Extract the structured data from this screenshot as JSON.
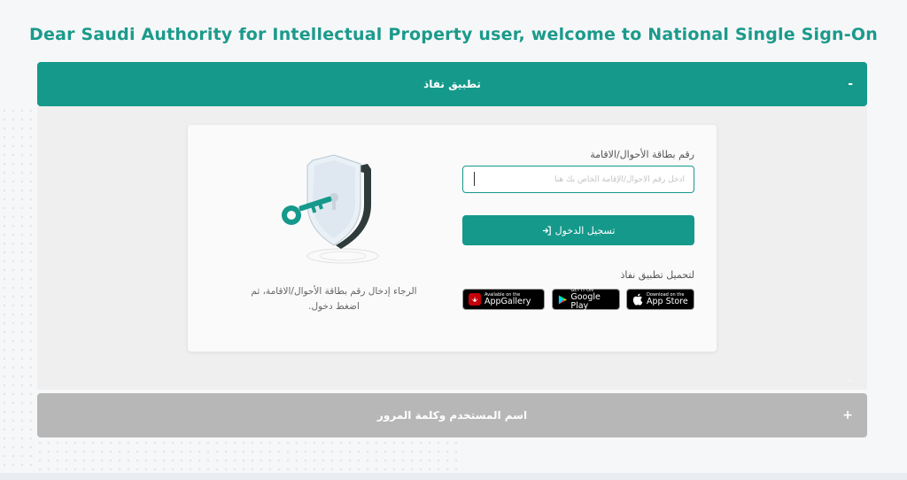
{
  "header": {
    "welcome": "Dear Saudi Authority for Intellectual Property user, welcome to National Single Sign-On"
  },
  "nafath_section": {
    "title": "تطبيق نفاذ",
    "toggle": "-",
    "collapse_marker": "-",
    "id_label": "رقم بطاقة الأحوال/الاقامة",
    "id_placeholder": "ادخل رقم الأحوال/الإقامة الخاص بك هنا",
    "id_value": "",
    "login_button": "تسجيل الدخول",
    "login_icon": "sign-in-icon",
    "download_label": "لتحميل تطبيق نفاذ",
    "stores": {
      "appstore": {
        "small": "Download on the",
        "big": "App Store",
        "icon": "apple-icon"
      },
      "gplay": {
        "small": "GET IT ON",
        "big": "Google Play",
        "icon": "google-play-icon"
      },
      "huawei": {
        "small": "Available on the",
        "big": "AppGallery",
        "icon": "huawei-icon"
      }
    },
    "help_text": "الرجاء إدخال رقم بطاقة الأحوال/الاقامة، ثم اضغط دخول."
  },
  "userpass_section": {
    "title": "اسم المستخدم وكلمة المرور",
    "toggle": "+"
  },
  "colors": {
    "primary": "#15998b",
    "heading": "#1b9a8b",
    "inactive": "#b7b7b7"
  }
}
